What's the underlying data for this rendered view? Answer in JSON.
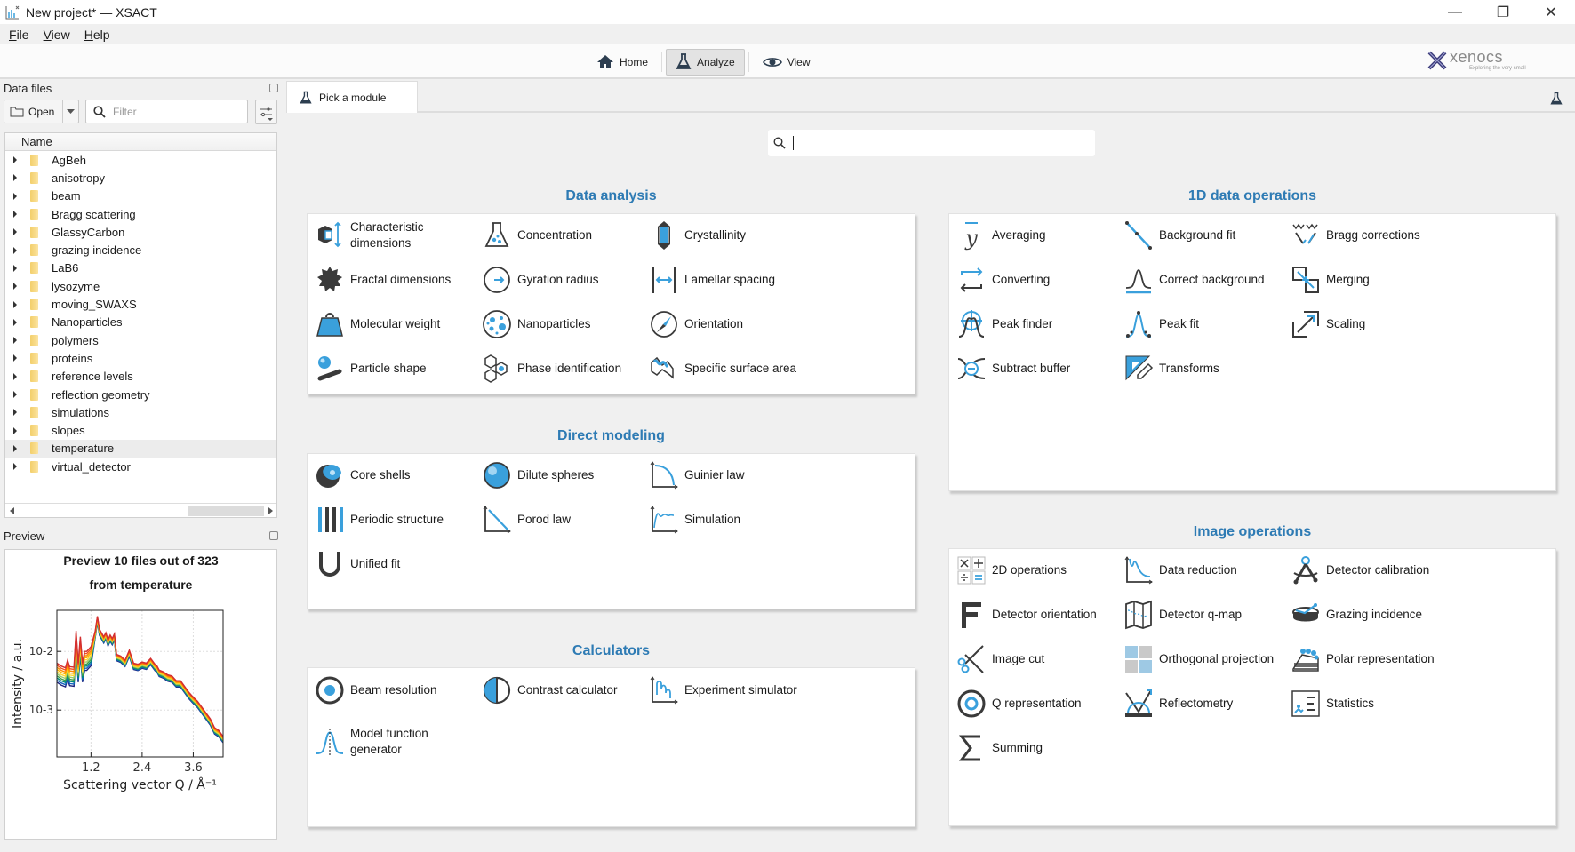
{
  "window": {
    "title": "New project* — XSACT",
    "controls": {
      "minimize": "—",
      "maximize": "❐",
      "close": "✕"
    }
  },
  "menu": [
    "File",
    "View",
    "Help"
  ],
  "toolbar": {
    "buttons": [
      {
        "label": "Home",
        "icon": "home-icon"
      },
      {
        "label": "Analyze",
        "icon": "flask-icon",
        "active": true
      },
      {
        "label": "View",
        "icon": "eye-icon"
      }
    ],
    "logo": {
      "name": "xenocs",
      "tagline": "Exploring the very small"
    }
  },
  "data_files": {
    "title": "Data files",
    "open_label": "Open",
    "filter_placeholder": "Filter",
    "column_header": "Name",
    "folders": [
      "AgBeh",
      "anisotropy",
      "beam",
      "Bragg scattering",
      "GlassyCarbon",
      "grazing incidence",
      "LaB6",
      "lysozyme",
      "moving_SWAXS",
      "Nanoparticles",
      "polymers",
      "proteins",
      "reference levels",
      "reflection geometry",
      "simulations",
      "slopes",
      "temperature",
      "virtual_detector"
    ],
    "selected": "temperature"
  },
  "preview": {
    "title": "Preview",
    "chart_title_1": "Preview 10 files out of 323",
    "chart_title_2": "from temperature",
    "chart_data": {
      "type": "line",
      "title": "Preview 10 files out of 323 from temperature",
      "xlabel": "Scattering vector Q / Å⁻¹",
      "ylabel": "Intensity / a.u.",
      "x_ticks": [
        "1.2",
        "2.4",
        "3.6"
      ],
      "y_ticks": [
        "10-2",
        "10-3"
      ],
      "xlim": [
        0.4,
        4.3
      ],
      "ylim_log10": [
        -3.8,
        -1.3
      ],
      "yscale": "log",
      "grid": true,
      "n_series": 10,
      "series_colors": [
        "#1a237e",
        "#1565c0",
        "#00897b",
        "#43a047",
        "#9ccc65",
        "#fdd835",
        "#ffb300",
        "#fb8c00",
        "#f4511e",
        "#d32f2f"
      ],
      "x": [
        0.4,
        0.5,
        0.6,
        0.65,
        0.7,
        0.8,
        0.85,
        0.9,
        0.95,
        1.0,
        1.05,
        1.1,
        1.2,
        1.3,
        1.35,
        1.4,
        1.5,
        1.55,
        1.6,
        1.65,
        1.7,
        1.75,
        1.8,
        1.9,
        2.0,
        2.1,
        2.2,
        2.3,
        2.4,
        2.5,
        2.6,
        2.7,
        2.75,
        2.8,
        2.9,
        3.0,
        3.1,
        3.2,
        3.3,
        3.4,
        3.5,
        3.6,
        3.7,
        3.8,
        3.9,
        4.0,
        4.1,
        4.2,
        4.3
      ],
      "y_log10": [
        -2.2,
        -2.25,
        -2.28,
        -2.15,
        -2.26,
        -2.27,
        -1.65,
        -2.2,
        -1.75,
        -2.2,
        -2.0,
        -2.0,
        -1.92,
        -1.65,
        -1.4,
        -1.62,
        -1.75,
        -1.68,
        -1.8,
        -1.72,
        -1.78,
        -1.7,
        -2.05,
        -2.08,
        -2.15,
        -1.98,
        -2.2,
        -2.22,
        -2.18,
        -2.2,
        -2.12,
        -2.22,
        -2.25,
        -2.32,
        -2.35,
        -2.4,
        -2.42,
        -2.5,
        -2.5,
        -2.6,
        -2.7,
        -2.78,
        -2.85,
        -2.95,
        -3.05,
        -3.15,
        -3.3,
        -3.35,
        -3.45
      ]
    }
  },
  "main": {
    "tab_label": "Pick a module",
    "search_value": "",
    "sections": [
      {
        "title": "Data analysis",
        "items": [
          {
            "label": "Characteristic dimensions",
            "icon": "characteristic-dimensions-icon"
          },
          {
            "label": "Concentration",
            "icon": "concentration-icon"
          },
          {
            "label": "Crystallinity",
            "icon": "crystallinity-icon"
          },
          {
            "label": "Fractal dimensions",
            "icon": "fractal-dimensions-icon"
          },
          {
            "label": "Gyration radius",
            "icon": "gyration-radius-icon"
          },
          {
            "label": "Lamellar spacing",
            "icon": "lamellar-spacing-icon"
          },
          {
            "label": "Molecular weight",
            "icon": "molecular-weight-icon"
          },
          {
            "label": "Nanoparticles",
            "icon": "nanoparticles-icon"
          },
          {
            "label": "Orientation",
            "icon": "orientation-icon"
          },
          {
            "label": "Particle shape",
            "icon": "particle-shape-icon"
          },
          {
            "label": "Phase identification",
            "icon": "phase-identification-icon"
          },
          {
            "label": "Specific surface area",
            "icon": "specific-surface-area-icon"
          }
        ]
      },
      {
        "title": "Direct modeling",
        "items": [
          {
            "label": "Core shells",
            "icon": "core-shells-icon"
          },
          {
            "label": "Dilute spheres",
            "icon": "dilute-spheres-icon"
          },
          {
            "label": "Guinier law",
            "icon": "guinier-law-icon"
          },
          {
            "label": "Periodic structure",
            "icon": "periodic-structure-icon"
          },
          {
            "label": "Porod law",
            "icon": "porod-law-icon"
          },
          {
            "label": "Simulation",
            "icon": "simulation-icon"
          },
          {
            "label": "Unified fit",
            "icon": "unified-fit-icon"
          }
        ]
      },
      {
        "title": "Calculators",
        "items": [
          {
            "label": "Beam resolution",
            "icon": "beam-resolution-icon"
          },
          {
            "label": "Contrast calculator",
            "icon": "contrast-calculator-icon"
          },
          {
            "label": "Experiment simulator",
            "icon": "experiment-simulator-icon"
          },
          {
            "label": "Model function generator",
            "icon": "model-function-generator-icon"
          }
        ]
      },
      {
        "title": "1D data operations",
        "items": [
          {
            "label": "Averaging",
            "icon": "averaging-icon"
          },
          {
            "label": "Background fit",
            "icon": "background-fit-icon"
          },
          {
            "label": "Bragg corrections",
            "icon": "bragg-corrections-icon"
          },
          {
            "label": "Converting",
            "icon": "converting-icon"
          },
          {
            "label": "Correct background",
            "icon": "correct-background-icon"
          },
          {
            "label": "Merging",
            "icon": "merging-icon"
          },
          {
            "label": "Peak finder",
            "icon": "peak-finder-icon"
          },
          {
            "label": "Peak fit",
            "icon": "peak-fit-icon"
          },
          {
            "label": "Scaling",
            "icon": "scaling-icon"
          },
          {
            "label": "Subtract buffer",
            "icon": "subtract-buffer-icon"
          },
          {
            "label": "Transforms",
            "icon": "transforms-icon"
          }
        ]
      },
      {
        "title": "Image operations",
        "items": [
          {
            "label": "2D operations",
            "icon": "2d-operations-icon"
          },
          {
            "label": "Data reduction",
            "icon": "data-reduction-icon"
          },
          {
            "label": "Detector calibration",
            "icon": "detector-calibration-icon"
          },
          {
            "label": "Detector orientation",
            "icon": "detector-orientation-icon"
          },
          {
            "label": "Detector q-map",
            "icon": "detector-q-map-icon"
          },
          {
            "label": "Grazing incidence",
            "icon": "grazing-incidence-icon"
          },
          {
            "label": "Image cut",
            "icon": "image-cut-icon"
          },
          {
            "label": "Orthogonal projection",
            "icon": "orthogonal-projection-icon"
          },
          {
            "label": "Polar representation",
            "icon": "polar-representation-icon"
          },
          {
            "label": "Q representation",
            "icon": "q-representation-icon"
          },
          {
            "label": "Reflectometry",
            "icon": "reflectometry-icon"
          },
          {
            "label": "Statistics",
            "icon": "statistics-icon"
          },
          {
            "label": "Summing",
            "icon": "summing-icon"
          }
        ]
      }
    ]
  },
  "colors": {
    "accent": "#2e7bb4",
    "icon_blue": "#3aa0dc",
    "icon_dark": "#3a3a3a"
  }
}
